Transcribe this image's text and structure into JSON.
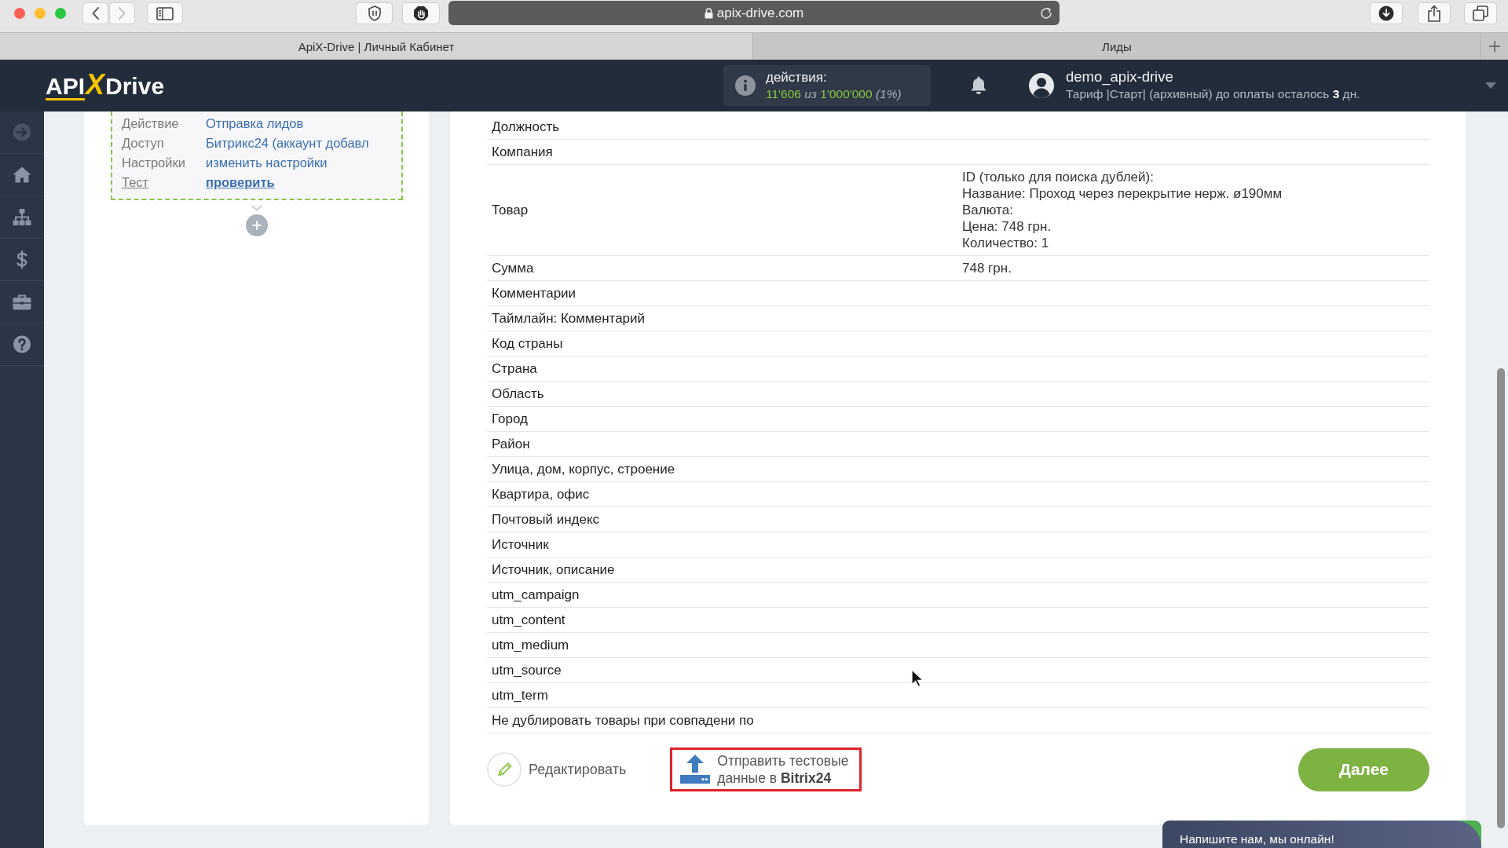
{
  "browser": {
    "navigation": {
      "back": {
        "disabled": false
      },
      "forward": {
        "disabled": true
      }
    },
    "url": "apix-drive.com",
    "tabs": [
      {
        "label": "ApiX-Drive | Личный Кабинет",
        "selected": true
      },
      {
        "label": "Лиды",
        "selected": false
      }
    ]
  },
  "header": {
    "logo": {
      "left": "API",
      "mark": "X",
      "right": "Drive"
    },
    "actions": {
      "label": "действия:",
      "count": "11'606 *из* 1'000'000 *(1%)*"
    },
    "user": {
      "name": "demo_apix-drive",
      "plan": "Тариф |Старт| (архивный) до оплаты осталось **3** дн."
    }
  },
  "connection": {
    "rows": [
      {
        "label": "Действие",
        "value": "Отправка лидов",
        "selected": false
      },
      {
        "label": "Доступ",
        "value": "Битрикс24 (аккаунт добавл",
        "selected": false
      },
      {
        "label": "Настройки",
        "value": "изменить настройки",
        "selected": false
      },
      {
        "label": "Тест",
        "value": "проверить",
        "selected": true
      }
    ]
  },
  "fields": {
    "rows": [
      {
        "label": "Должность"
      },
      {
        "label": "Компания"
      },
      {
        "label": "Товар",
        "value": [
          "ID (только для поиска дублей):",
          "Название: Проход через перекрытие нерж. ø190мм",
          "Валюта:",
          "Цена: 748 грн.",
          "Количество: 1"
        ]
      },
      {
        "label": "Сумма",
        "value": [
          "748 грн."
        ]
      },
      {
        "label": "Комментарии"
      },
      {
        "label": "Таймлайн: Комментарий"
      },
      {
        "label": "Код страны"
      },
      {
        "label": "Страна"
      },
      {
        "label": "Область"
      },
      {
        "label": "Город"
      },
      {
        "label": "Район"
      },
      {
        "label": "Улица, дом, корпус, строение"
      },
      {
        "label": "Квартира, офис"
      },
      {
        "label": "Почтовый индекс"
      },
      {
        "label": "Источник"
      },
      {
        "label": "Источник, описание"
      },
      {
        "label": "utm_campaign"
      },
      {
        "label": "utm_content"
      },
      {
        "label": "utm_medium"
      },
      {
        "label": "utm_source"
      },
      {
        "label": "utm_term"
      },
      {
        "label": "Не дублировать товары при совпадени по"
      }
    ]
  },
  "footer": {
    "edit": "Редактировать",
    "send": {
      "lines": [
        "Отправить тестовые",
        "данные в **Bitrix24**"
      ],
      "highlighted": true
    },
    "next": "Далее"
  },
  "chat": {
    "text": "Напишите нам, мы онлайн!"
  }
}
